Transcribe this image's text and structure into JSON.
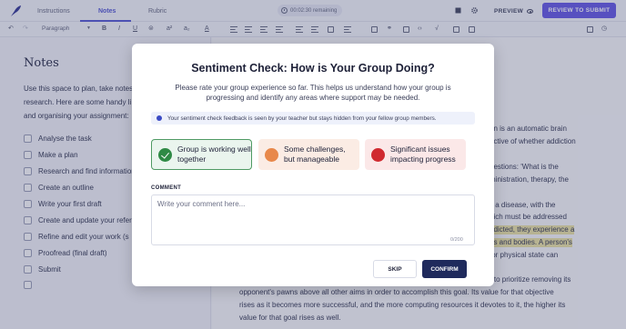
{
  "colors": {
    "accent": "#6a5ee8",
    "tab_active": "#5b5fd6",
    "confirm_bg": "#1f2a5c",
    "good": "#2f8a45",
    "some": "#e8884a",
    "significant": "#d02a30"
  },
  "header": {
    "tabs": [
      "Instructions",
      "Notes",
      "Rubric"
    ],
    "timer": "00:02:30 remaining",
    "preview_label": "PREVIEW",
    "review_label": "REVIEW TO SUBMIT",
    "icons": [
      "logo-feather-icon",
      "clock-icon",
      "book-icon",
      "gear-icon",
      "eye-icon"
    ]
  },
  "toolbar": {
    "paragraph_label": "Paragraph",
    "bold": "B",
    "italic": "I",
    "underline": "U",
    "superscript": "a²",
    "subscript": "a₂",
    "text_color": "A"
  },
  "notes": {
    "title": "Notes",
    "intro": [
      "Use this space to plan, take notes",
      "research. Here are some handy li",
      "and organising your assignment:"
    ],
    "checklist": [
      "Analyse the task",
      "Make a plan",
      "Research and find information",
      "Create an outline",
      "Write your first draft",
      "Create and update your references",
      "Refine and edit your work (s",
      "Proofread (final draft)",
      "Submit",
      ""
    ]
  },
  "editor": {
    "lines": [
      "on is an automatic brain",
      "ective of whether addiction",
      "uestions: 'What is the",
      "ministration, therapy, the",
      "s a disease, with the",
      "hich must be addressed",
      "ddicted, they experience a",
      "ds and bodies. A person's",
      "for physical state can",
      "r to prioritize removing its",
      "opponent's pawns above all other aims in order to accomplish this goal. Its value for that objective",
      "rises as it becomes more successful, and the more computing resources it devotes to it, the higher its",
      "value for that goal rises as well."
    ]
  },
  "modal": {
    "title": "Sentiment Check: How is Your Group Doing?",
    "description": [
      "Please rate your group experience so far. This helps us understand how your group is",
      "progressing and identify any areas where support may be needed."
    ],
    "info": "Your sentiment check feedback is seen by your teacher but stays hidden from your fellow group members.",
    "options": [
      {
        "line1": "Group is working well",
        "line2": "together",
        "selected": true
      },
      {
        "line1": "Some challenges,",
        "line2": "but manageable",
        "selected": false
      },
      {
        "line1": "Significant issues",
        "line2": "impacting progress",
        "selected": false
      }
    ],
    "comment_label": "COMMENT",
    "comment_placeholder": "Write your comment here...",
    "counter": "0/200",
    "skip_label": "SKIP",
    "confirm_label": "CONFIRM"
  }
}
